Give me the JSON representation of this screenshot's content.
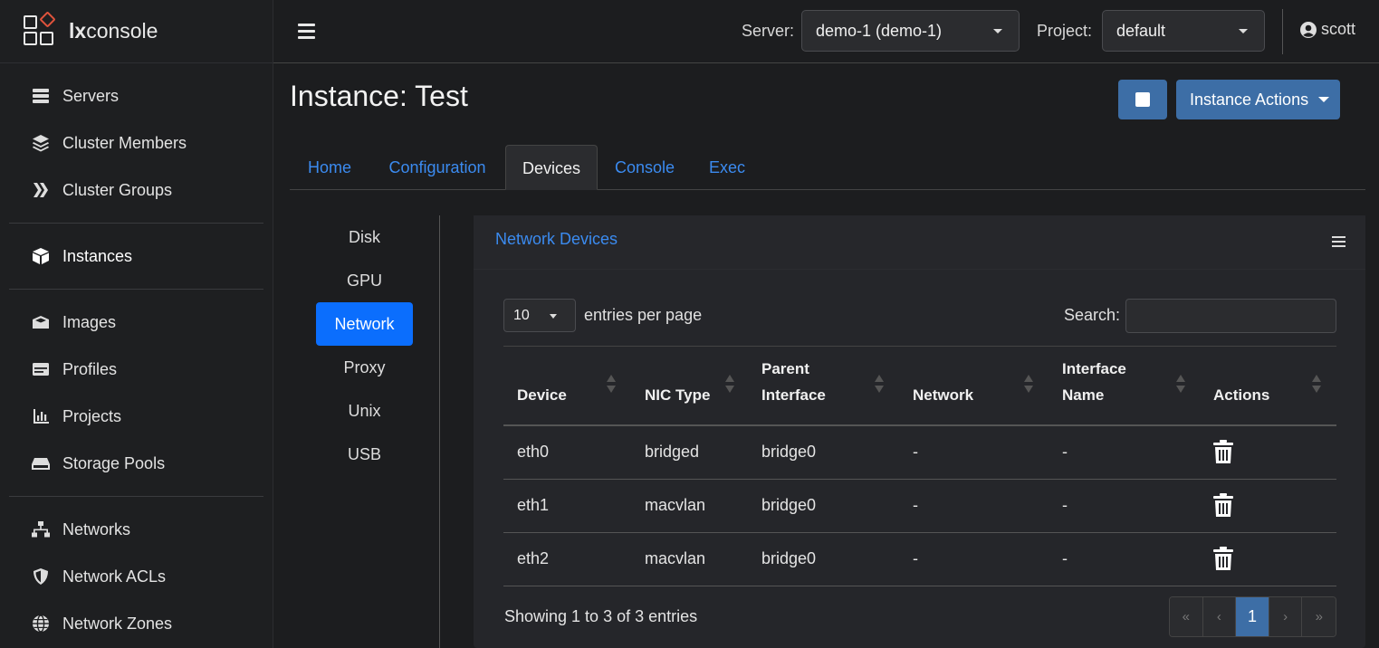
{
  "brand": {
    "prefix": "lx",
    "suffix": "console"
  },
  "sidebar": {
    "groups": [
      [
        {
          "label": "Servers",
          "icon": "servers-icon"
        },
        {
          "label": "Cluster Members",
          "icon": "layers-icon"
        },
        {
          "label": "Cluster Groups",
          "icon": "cluster-groups-icon"
        }
      ],
      [
        {
          "label": "Instances",
          "icon": "cube-icon"
        }
      ],
      [
        {
          "label": "Images",
          "icon": "images-icon"
        },
        {
          "label": "Profiles",
          "icon": "id-card-icon"
        },
        {
          "label": "Projects",
          "icon": "chart-icon"
        },
        {
          "label": "Storage Pools",
          "icon": "hdd-icon"
        }
      ],
      [
        {
          "label": "Networks",
          "icon": "network-icon"
        },
        {
          "label": "Network ACLs",
          "icon": "shield-icon"
        },
        {
          "label": "Network Zones",
          "icon": "globe-icon"
        }
      ]
    ]
  },
  "topbar": {
    "server_label": "Server:",
    "server_value": "demo-1 (demo-1)",
    "project_label": "Project:",
    "project_value": "default",
    "user": "scott"
  },
  "page": {
    "title": "Instance: Test",
    "actions_label": "Instance Actions"
  },
  "tabs": [
    "Home",
    "Configuration",
    "Devices",
    "Console",
    "Exec"
  ],
  "device_types": [
    "Disk",
    "GPU",
    "Network",
    "Proxy",
    "Unix",
    "USB"
  ],
  "card": {
    "title": "Network Devices",
    "per_page": "10",
    "per_page_label": "entries per page",
    "search_label": "Search:",
    "search_value": "",
    "columns": [
      {
        "l1": "",
        "l2": "Device"
      },
      {
        "l1": "",
        "l2": "NIC Type"
      },
      {
        "l1": "Parent",
        "l2": "Interface"
      },
      {
        "l1": "",
        "l2": "Network"
      },
      {
        "l1": "Interface",
        "l2": "Name"
      },
      {
        "l1": "",
        "l2": "Actions"
      }
    ],
    "rows": [
      [
        "eth0",
        "bridged",
        "bridge0",
        "-",
        "-"
      ],
      [
        "eth1",
        "macvlan",
        "bridge0",
        "-",
        "-"
      ],
      [
        "eth2",
        "macvlan",
        "bridge0",
        "-",
        "-"
      ]
    ],
    "info": "Showing 1 to 3 of 3 entries",
    "pager": [
      "«",
      "‹",
      "1",
      "›",
      "»"
    ]
  },
  "colors": {
    "accent": "#3d6ea6",
    "link": "#3b8bf0",
    "active_pill": "#0b6efd"
  }
}
